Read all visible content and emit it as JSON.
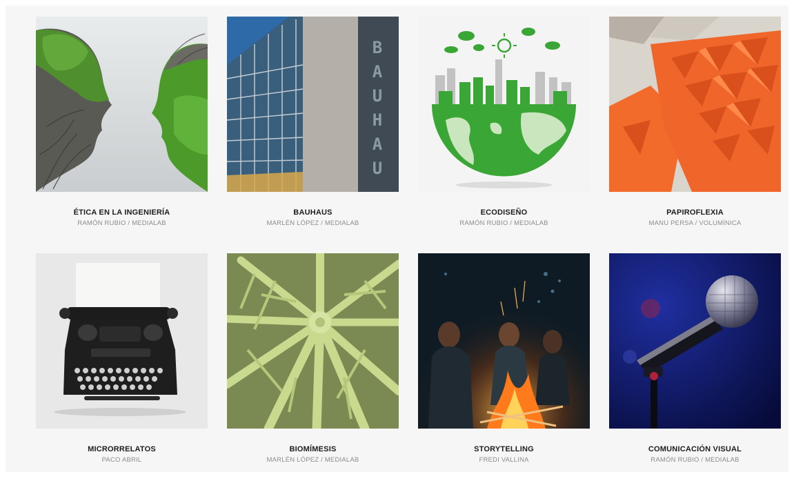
{
  "courses": [
    {
      "title": "ÉTICA EN LA INGENIERÍA",
      "author": "RAMÓN RUBIO / MEDIALAB",
      "image": "tree-heads"
    },
    {
      "title": "BAUHAUS",
      "author": "MARLÉN LÓPEZ / MEDIALAB",
      "image": "bauhaus-building"
    },
    {
      "title": "ECODISEÑO",
      "author": "RAMÓN RUBIO / MEDIALAB",
      "image": "green-earth-city"
    },
    {
      "title": "PAPIROFLEXIA",
      "author": "MANU PERSA / VOLUMÍNICA",
      "image": "orange-origami"
    },
    {
      "title": "MICRORRELATOS",
      "author": "PACO ABRIL",
      "image": "typewriter"
    },
    {
      "title": "BIOMÍMESIS",
      "author": "MARLÉN LÓPEZ / MEDIALAB",
      "image": "lily-pad-veins"
    },
    {
      "title": "STORYTELLING",
      "author": "FREDI VALLINA",
      "image": "campfire"
    },
    {
      "title": "COMUNICACIÓN VISUAL",
      "author": "RAMÓN RUBIO / MEDIALAB",
      "image": "microphone"
    }
  ],
  "bauhaus_sign": "BAUHAU",
  "colors": {
    "panel": "#f6f6f7",
    "title": "#1d1d1f",
    "author": "#8c8c8c"
  }
}
